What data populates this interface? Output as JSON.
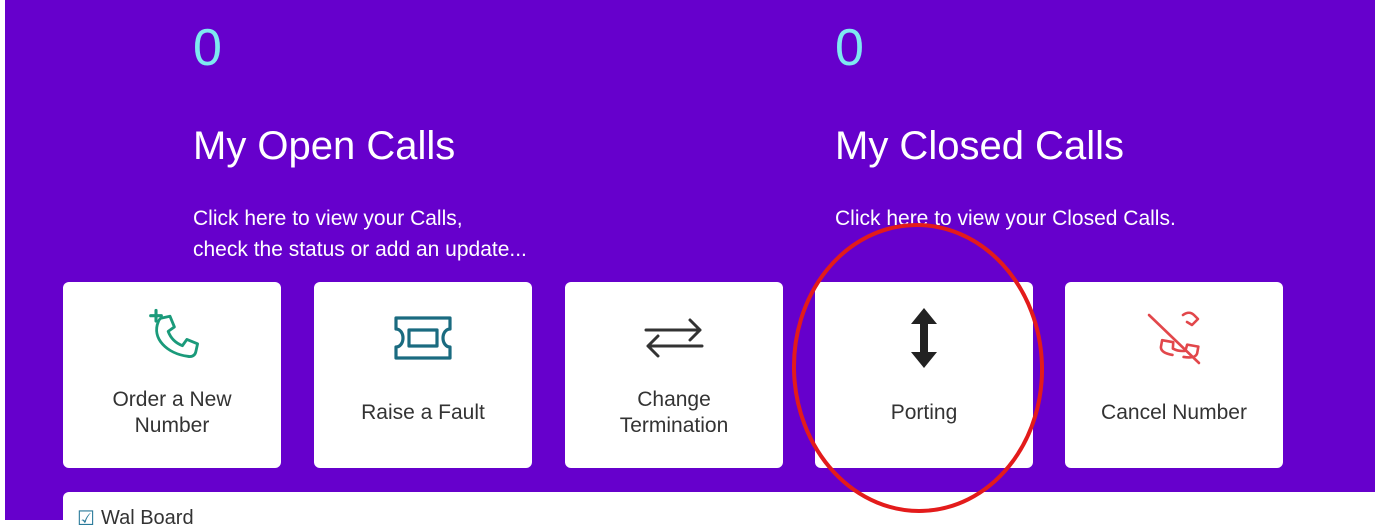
{
  "open_calls": {
    "count": "0",
    "title": "My Open Calls",
    "desc_line1": "Click here to view your Calls,",
    "desc_line2": "check the status or add an update..."
  },
  "closed_calls": {
    "count": "0",
    "title": "My Closed Calls",
    "desc_line1": "Click here to view your Closed Calls."
  },
  "tiles": [
    {
      "label": "Order a New Number",
      "icon": "phone-add-icon",
      "color": "#1a9a7a"
    },
    {
      "label": "Raise a Fault",
      "icon": "ticket-icon",
      "color": "#1a6b80"
    },
    {
      "label": "Change Termination",
      "icon": "arrows-exchange-icon",
      "color": "#333333"
    },
    {
      "label": "Porting",
      "icon": "arrows-vertical-icon",
      "color": "#222222"
    },
    {
      "label": "Cancel Number",
      "icon": "phone-cancel-icon",
      "color": "#e2474b"
    }
  ],
  "work_board": {
    "label": "Wal Board",
    "icon": "checklist-icon"
  },
  "colors": {
    "hero_bg": "#6600cc",
    "count": "#7ee8f0",
    "highlight": "#e31b1b"
  }
}
